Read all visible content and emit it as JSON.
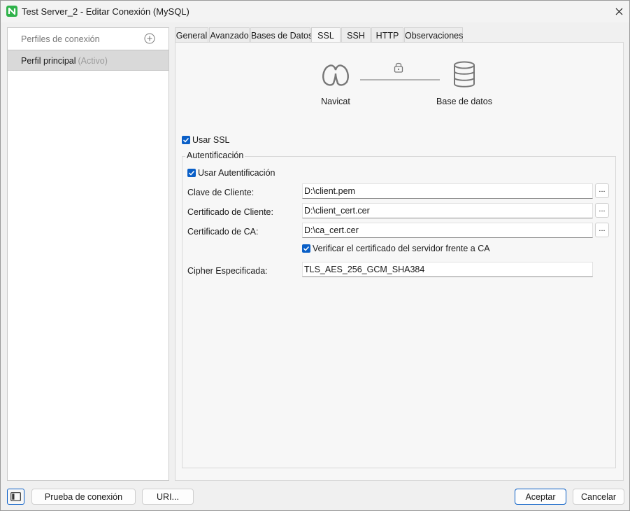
{
  "window": {
    "title": "Test Server_2 - Editar Conexión (MySQL)"
  },
  "profiles": {
    "header_label": "Perfiles de conexión",
    "items": [
      {
        "name": "Perfil principal",
        "status": "(Activo)"
      }
    ]
  },
  "tabs": [
    {
      "label": "General",
      "active": false
    },
    {
      "label": "Avanzado",
      "active": false
    },
    {
      "label": "Bases de Datos",
      "active": false
    },
    {
      "label": "SSL",
      "active": true
    },
    {
      "label": "SSH",
      "active": false
    },
    {
      "label": "HTTP",
      "active": false
    },
    {
      "label": "Observaciones",
      "active": false
    }
  ],
  "diagram": {
    "left_label": "Navicat",
    "right_label": "Base de datos",
    "left_icon": "navicat-logo-icon",
    "middle_icon": "lock-icon",
    "right_icon": "database-icon"
  },
  "ssl": {
    "use_ssl_label": "Usar SSL",
    "use_ssl_checked": true,
    "auth_group_title": "Autentificación",
    "use_auth_label": "Usar Autentificación",
    "use_auth_checked": true,
    "client_key_label": "Clave de Cliente:",
    "client_key_value": "D:\\client.pem",
    "client_cert_label": "Certificado de Cliente:",
    "client_cert_value": "D:\\client_cert.cer",
    "ca_cert_label": "Certificado de CA:",
    "ca_cert_value": "D:\\ca_cert.cer",
    "verify_label": "Verificar el certificado del servidor frente a CA",
    "verify_checked": true,
    "cipher_label": "Cipher Especificada:",
    "cipher_value": "TLS_AES_256_GCM_SHA384",
    "browse_label": "..."
  },
  "footer": {
    "test_button": "Prueba de conexión",
    "uri_button": "URI...",
    "ok_button": "Aceptar",
    "cancel_button": "Cancelar"
  },
  "colors": {
    "accent": "#0a5fc7",
    "app_icon": "#2fb24a",
    "selected_row": "#d9d9d9"
  }
}
